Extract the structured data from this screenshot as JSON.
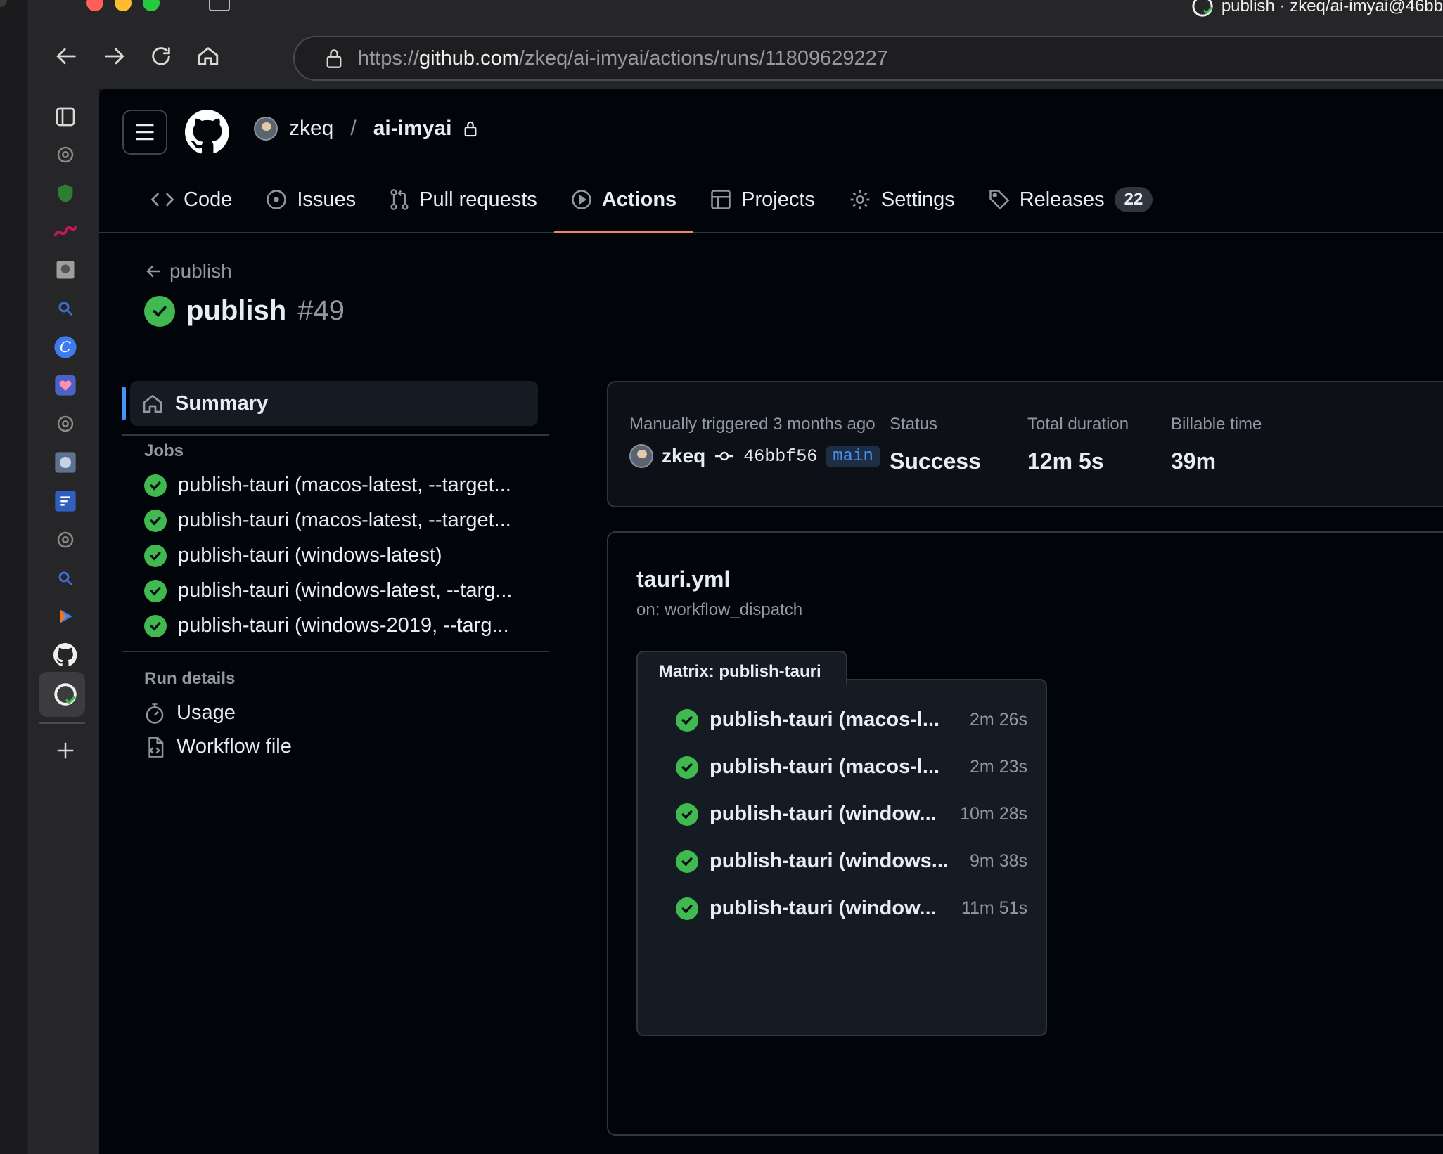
{
  "browser": {
    "tab_title": "publish · zkeq/ai-imyai@46bb",
    "url_scheme": "https://",
    "url_host": "github.com",
    "url_path": "/zkeq/ai-imyai/actions/runs/11809629227"
  },
  "repo": {
    "owner": "zkeq",
    "separator": "/",
    "name": "ai-imyai"
  },
  "tabs": [
    {
      "label": "Code",
      "icon": "code-icon"
    },
    {
      "label": "Issues",
      "icon": "issue-icon"
    },
    {
      "label": "Pull requests",
      "icon": "pull-request-icon"
    },
    {
      "label": "Actions",
      "icon": "play-icon",
      "active": true
    },
    {
      "label": "Projects",
      "icon": "table-icon"
    },
    {
      "label": "Settings",
      "icon": "gear-icon"
    },
    {
      "label": "Releases",
      "icon": "tag-icon",
      "count": "22"
    }
  ],
  "run": {
    "back_label": "publish",
    "title": "publish",
    "number": "#49"
  },
  "nav": {
    "summary_label": "Summary",
    "jobs_heading": "Jobs",
    "jobs": [
      "publish-tauri (macos-latest, --target...",
      "publish-tauri (macos-latest, --target...",
      "publish-tauri (windows-latest)",
      "publish-tauri (windows-latest, --targ...",
      "publish-tauri (windows-2019, --targ..."
    ],
    "run_details_heading": "Run details",
    "usage_label": "Usage",
    "workflow_file_label": "Workflow file"
  },
  "summary": {
    "trigger_label": "Manually triggered 3 months ago",
    "actor": "zkeq",
    "commit": "46bbf56",
    "branch": "main",
    "status_label": "Status",
    "status_value": "Success",
    "duration_label": "Total duration",
    "duration_value": "12m 5s",
    "billable_label": "Billable time",
    "billable_value": "39m"
  },
  "workflow": {
    "file": "tauri.yml",
    "trigger": "on: workflow_dispatch",
    "matrix_label": "Matrix: publish-tauri",
    "jobs": [
      {
        "name": "publish-tauri (macos-l...",
        "duration": "2m 26s"
      },
      {
        "name": "publish-tauri (macos-l...",
        "duration": "2m 23s"
      },
      {
        "name": "publish-tauri (window...",
        "duration": "10m 28s"
      },
      {
        "name": "publish-tauri (windows...",
        "duration": "9m 38s"
      },
      {
        "name": "publish-tauri (window...",
        "duration": "11m 51s"
      }
    ]
  },
  "colors": {
    "success": "#3fb950",
    "active_tab_underline": "#f78166",
    "accent": "#4493f8"
  }
}
